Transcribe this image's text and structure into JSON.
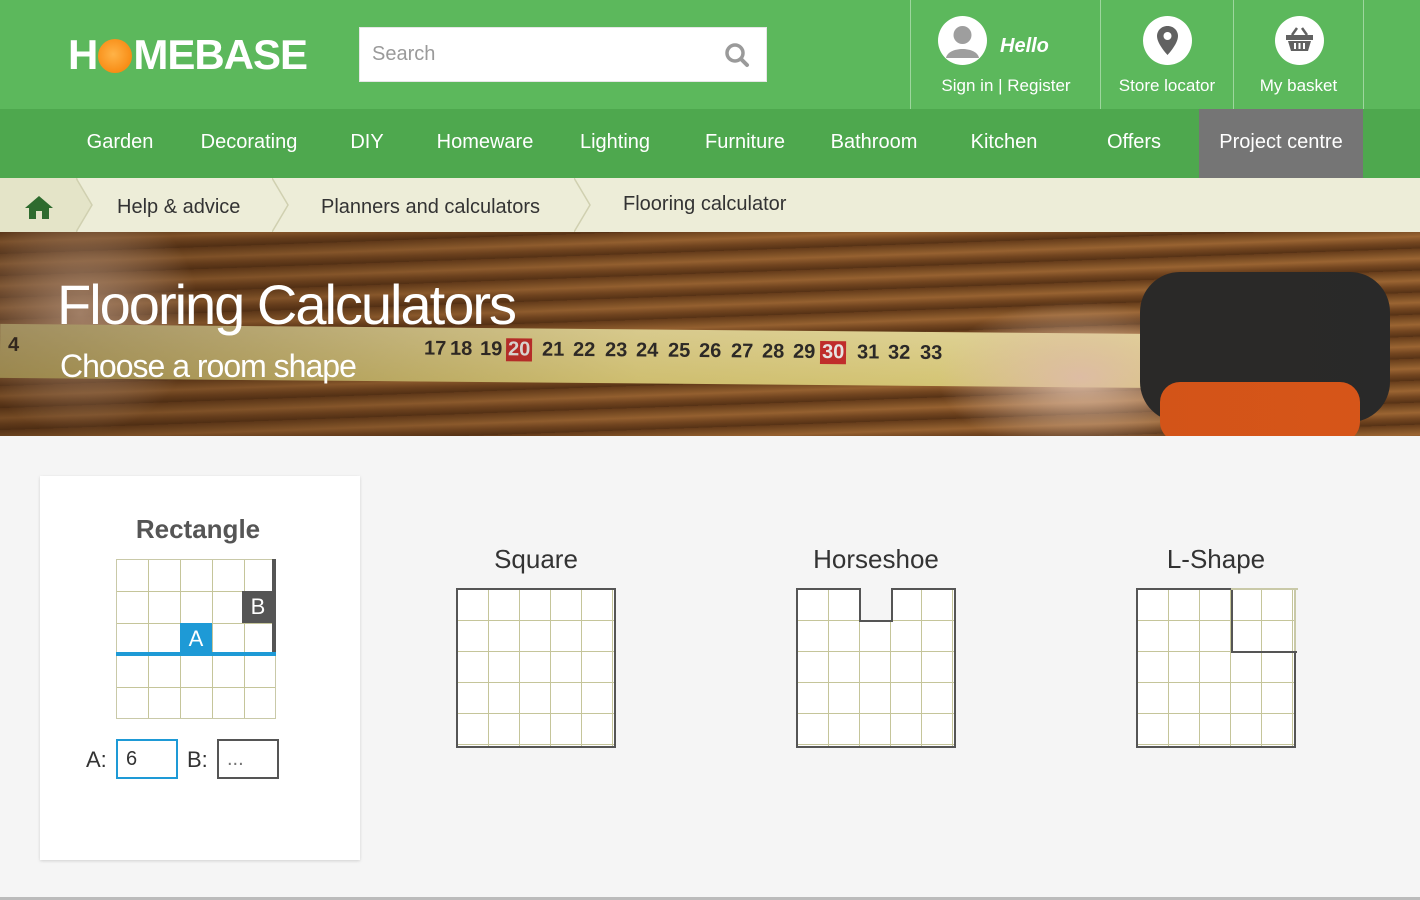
{
  "header": {
    "logo_text_a": "H",
    "logo_text_b": "MEBASE",
    "search_placeholder": "Search",
    "account": {
      "greeting": "Hello",
      "links": "Sign in | Register"
    },
    "store_locator": "Store locator",
    "basket": "My basket"
  },
  "nav": {
    "items": [
      "Garden",
      "Decorating",
      "DIY",
      "Homeware",
      "Lighting",
      "Furniture",
      "Bathroom",
      "Kitchen",
      "Offers",
      "Project centre"
    ],
    "active": "Project centre"
  },
  "breadcrumb": [
    "Help & advice",
    "Planners and calculators",
    "Flooring calculator"
  ],
  "hero": {
    "title": "Flooring Calculators",
    "subtitle": "Choose a room shape",
    "tape_numbers": [
      "4",
      "17",
      "18",
      "19",
      "20",
      "21",
      "22",
      "23",
      "24",
      "25",
      "26",
      "27",
      "28",
      "29",
      "30",
      "31",
      "32",
      "33"
    ]
  },
  "shapes": {
    "rectangle": {
      "title": "Rectangle",
      "label_a": "A",
      "label_b": "B",
      "field_a_label": "A:",
      "field_a_value": "6",
      "field_b_label": "B:",
      "field_b_placeholder": "..."
    },
    "square": {
      "title": "Square"
    },
    "horseshoe": {
      "title": "Horseshoe"
    },
    "lshape": {
      "title": "L-Shape"
    }
  },
  "colors": {
    "brand_green": "#5cb85c",
    "nav_green": "#4ea84e",
    "active_tab": "#757575",
    "accent_blue": "#1e9ad6",
    "home_icon_green": "#2e6b2e"
  }
}
